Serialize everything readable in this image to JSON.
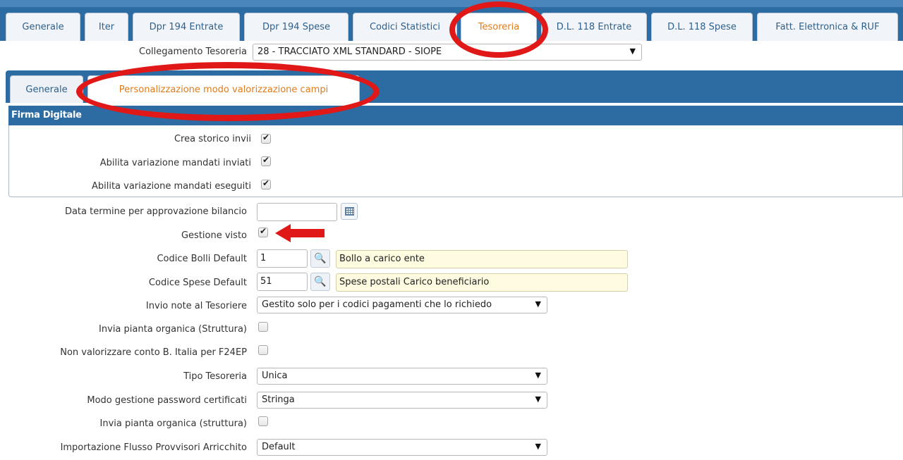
{
  "top_tabs": [
    {
      "label": "Generale"
    },
    {
      "label": "Iter"
    },
    {
      "label": "Dpr 194 Entrate"
    },
    {
      "label": "Dpr 194 Spese"
    },
    {
      "label": "Codici Statistici"
    },
    {
      "label": "Tesoreria"
    },
    {
      "label": "D.L. 118 Entrate"
    },
    {
      "label": "D.L. 118 Spese"
    },
    {
      "label": "Fatt. Elettronica & RUF"
    }
  ],
  "collegamento": {
    "label": "Collegamento Tesoreria",
    "value": "28 - TRACCIATO XML STANDARD - SIOPE"
  },
  "sub_tabs": [
    {
      "label": "Generale"
    },
    {
      "label": "Personalizzazione modo valorizzazione campi"
    }
  ],
  "firma_digitale": {
    "title": "Firma Digitale",
    "fields": [
      {
        "label": "Crea storico invii",
        "checked": true
      },
      {
        "label": "Abilita variazione mandati inviati",
        "checked": true
      },
      {
        "label": "Abilita variazione mandati eseguiti",
        "checked": true
      }
    ]
  },
  "form": {
    "data_termine": {
      "label": "Data termine per approvazione bilancio",
      "value": ""
    },
    "gestione_visto": {
      "label": "Gestione visto",
      "checked": true
    },
    "codice_bolli": {
      "label": "Codice Bolli Default",
      "code": "1",
      "description": "Bollo a carico  ente"
    },
    "codice_spese": {
      "label": "Codice Spese Default",
      "code": "51",
      "description": "Spese postali Carico beneficiario"
    },
    "invio_note": {
      "label": "Invio note al Tesoriere",
      "value": "Gestito solo per i codici pagamenti che lo richiedo"
    },
    "invia_pianta_1": {
      "label": "Invia pianta organica (Struttura)",
      "checked": false
    },
    "non_valorizzare": {
      "label": "Non valorizzare conto B. Italia per F24EP",
      "checked": false
    },
    "tipo_tesoreria": {
      "label": "Tipo Tesoreria",
      "value": "Unica"
    },
    "modo_password": {
      "label": "Modo gestione password certificati",
      "value": "Stringa"
    },
    "invia_pianta_2": {
      "label": "Invia pianta organica (struttura)",
      "checked": false
    },
    "importazione": {
      "label": "Importazione Flusso Provvisori Arricchito",
      "value": "Default"
    }
  },
  "icons": {
    "dropdown": "▼",
    "search": "🔍",
    "calendar": "calendar-icon"
  },
  "colors": {
    "header_blue": "#2d6ca2",
    "active_tab_text": "#e07b1a",
    "tab_text": "#2e5f8a",
    "annotation_red": "#e01818",
    "readonly_yellow": "#fffbe0"
  }
}
